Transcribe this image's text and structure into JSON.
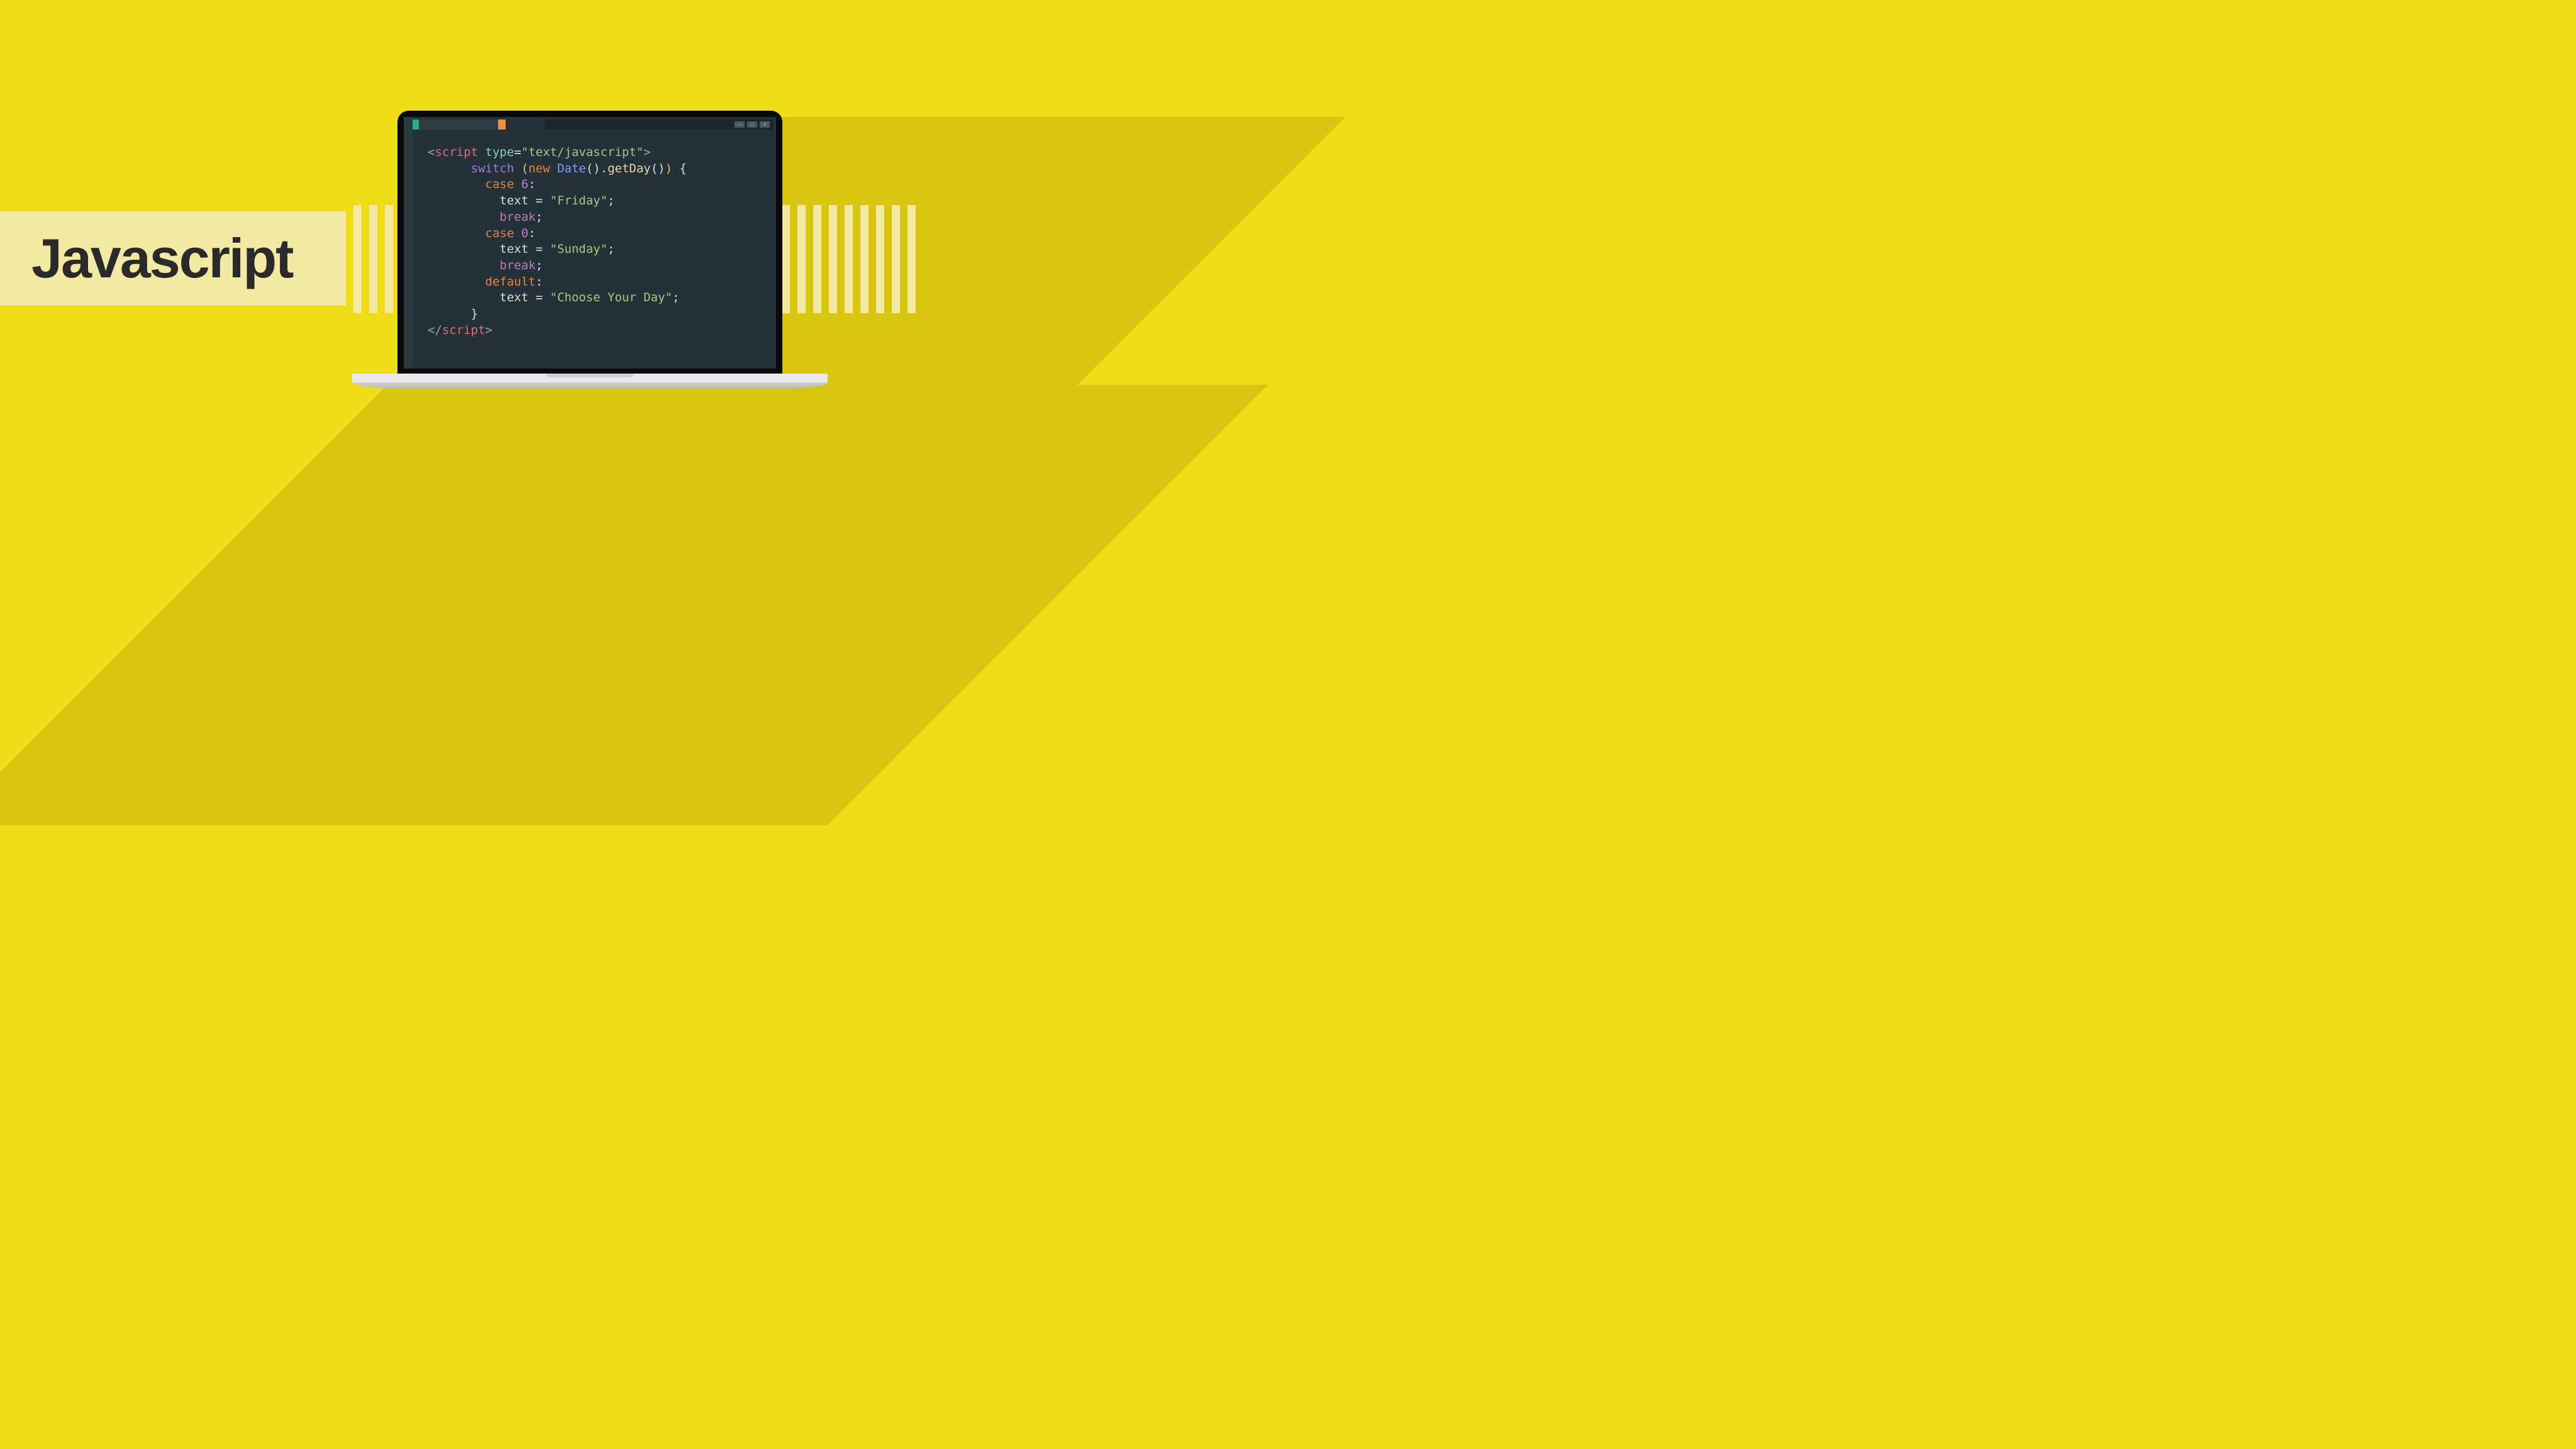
{
  "title": "Javascript",
  "window_controls": {
    "min": "—",
    "max": "□",
    "close": "x"
  },
  "code": {
    "l1": {
      "open": "<",
      "tag": "script",
      "sp": " ",
      "attr": "type",
      "eq": "=",
      "val": "\"text/javascript\"",
      "close": ">"
    },
    "l2": {
      "indent": "      ",
      "kw": "switch",
      "sp": " ",
      "p1": "(",
      "nw": "new",
      "sp2": " ",
      "cls": "Date",
      "par": "()",
      "dot": ".",
      "meth": "getDay",
      "par2": "()",
      "p2": ")",
      "sp3": " ",
      "brace": "{"
    },
    "l3": {
      "indent": "        ",
      "kw": "case",
      "sp": " ",
      "num": "6",
      "colon": ":"
    },
    "l4": {
      "indent": "          ",
      "var": "text",
      "sp": " ",
      "eq": "=",
      "sp2": " ",
      "str": "\"Friday\"",
      "semi": ";"
    },
    "l5": {
      "indent": "          ",
      "kw": "break",
      "semi": ";"
    },
    "l6": {
      "indent": "        ",
      "kw": "case",
      "sp": " ",
      "num": "0",
      "colon": ":"
    },
    "l7": {
      "indent": "          ",
      "var": "text",
      "sp": " ",
      "eq": "=",
      "sp2": " ",
      "str": "\"Sunday\"",
      "semi": ";"
    },
    "l8": {
      "indent": "          ",
      "kw": "break",
      "semi": ";"
    },
    "l9": {
      "indent": "        ",
      "kw": "default",
      "colon": ":"
    },
    "l10": {
      "indent": "          ",
      "var": "text",
      "sp": " ",
      "eq": "=",
      "sp2": " ",
      "str": "\"Choose Your Day\"",
      "semi": ";"
    },
    "l11": {
      "indent": "      ",
      "brace": "}"
    },
    "l12": {
      "open": "</",
      "tag": "script",
      "close": ">"
    }
  }
}
